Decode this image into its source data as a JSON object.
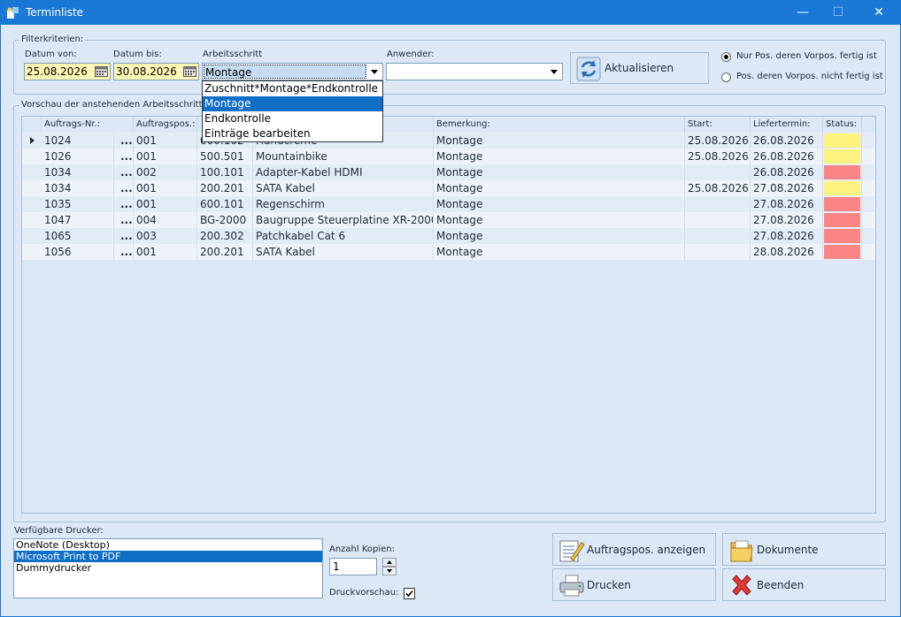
{
  "window": {
    "title": "Terminliste",
    "minimize": "—",
    "maximize": "☐",
    "close": "✕"
  },
  "filter": {
    "group_title": "Filterkriterien:",
    "date_from_label": "Datum von:",
    "date_from": "25.08.2026",
    "date_to_label": "Datum bis:",
    "date_to": "30.08.2026",
    "step_label": "Arbeitsschritt",
    "step_value": "Montage",
    "user_label": "Anwender:",
    "user_value": "",
    "refresh_label": "Aktualisieren",
    "radio_done": "Nur Pos. deren Vorpos. fertig ist",
    "radio_not_done": "Pos. deren Vorpos. nicht fertig ist",
    "dropdown_options": [
      "Zuschnitt*Montage*Endkontrolle",
      "Montage",
      "Endkontrolle",
      "Einträge bearbeiten"
    ]
  },
  "preview": {
    "group_title": "Vorschau der anstehenden Arbeitsschritte",
    "columns": [
      "Auftrags-Nr.:",
      "Auftragspos.:",
      "",
      "",
      "Bemerkung:",
      "Start:",
      "Liefertermin:",
      "Status:"
    ],
    "rows": [
      {
        "auftrag": "1024",
        "dots": "...",
        "pos": "001",
        "artnr": "000.102",
        "bez": "Handcreme",
        "bem": "Montage",
        "start": "25.08.2026",
        "liefer": "26.08.2026",
        "status": "#fbf37e"
      },
      {
        "auftrag": "1026",
        "dots": "...",
        "pos": "001",
        "artnr": "500.501",
        "bez": "Mountainbike",
        "bem": "Montage",
        "start": "25.08.2026",
        "liefer": "26.08.2026",
        "status": "#fbf37e"
      },
      {
        "auftrag": "1034",
        "dots": "...",
        "pos": "002",
        "artnr": "100.101",
        "bez": "Adapter-Kabel HDMI",
        "bem": "Montage",
        "start": "",
        "liefer": "26.08.2026",
        "status": "#fb8585"
      },
      {
        "auftrag": "1034",
        "dots": "...",
        "pos": "001",
        "artnr": "200.201",
        "bez": "SATA Kabel",
        "bem": "Montage",
        "start": "25.08.2026",
        "liefer": "27.08.2026",
        "status": "#fbf37e"
      },
      {
        "auftrag": "1035",
        "dots": "...",
        "pos": "001",
        "artnr": "600.101",
        "bez": "Regenschirm",
        "bem": "Montage",
        "start": "",
        "liefer": "27.08.2026",
        "status": "#fb8585"
      },
      {
        "auftrag": "1047",
        "dots": "...",
        "pos": "004",
        "artnr": "BG-2000",
        "bez": "Baugruppe Steuerplatine XR-2000",
        "bem": "Montage",
        "start": "",
        "liefer": "27.08.2026",
        "status": "#fb8585"
      },
      {
        "auftrag": "1065",
        "dots": "...",
        "pos": "003",
        "artnr": "200.302",
        "bez": "Patchkabel Cat 6",
        "bem": "Montage",
        "start": "",
        "liefer": "27.08.2026",
        "status": "#fb8585"
      },
      {
        "auftrag": "1056",
        "dots": "...",
        "pos": "001",
        "artnr": "200.201",
        "bez": "SATA Kabel",
        "bem": "Montage",
        "start": "",
        "liefer": "28.08.2026",
        "status": "#fb8585"
      }
    ]
  },
  "printers": {
    "label": "Verfügbare Drucker:",
    "items": [
      "OneNote (Desktop)",
      "Microsoft Print to PDF",
      "Dummydrucker"
    ]
  },
  "copies": {
    "label": "Anzahl Kopien:",
    "value": "1"
  },
  "preview_check": {
    "label": "Druckvorschau:"
  },
  "buttons": {
    "show_pos": "Auftragspos. anzeigen",
    "documents": "Dokumente",
    "print": "Drucken",
    "exit": "Beenden"
  },
  "colors": {
    "titlebar": "#1a78d6",
    "window_bg": "#dce8f5",
    "date_bg": "#fdf7b3",
    "status_yellow": "#fbf37e",
    "status_red": "#fb8585",
    "selection": "#0f6fc6"
  }
}
